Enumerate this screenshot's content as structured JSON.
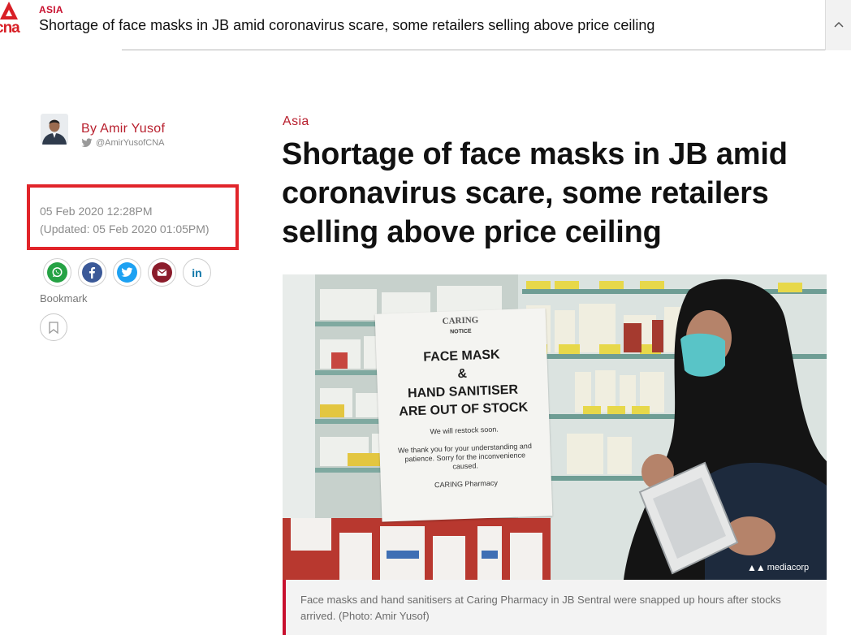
{
  "topbar": {
    "logo_text": "cna",
    "category": "ASIA",
    "title": "Shortage of face masks in JB amid coronavirus scare, some retailers selling above price ceiling",
    "collapse_icon": "chevron-up-icon"
  },
  "author": {
    "name": "By Amir Yusof",
    "handle": "@AmirYusofCNA",
    "handle_icon": "twitter-icon"
  },
  "dates": {
    "published": "05 Feb 2020 12:28PM",
    "updated": "(Updated: 05 Feb 2020 01:05PM)"
  },
  "share": {
    "buttons": [
      {
        "name": "whatsapp",
        "icon": "whatsapp-icon",
        "color": "#25a244"
      },
      {
        "name": "facebook",
        "icon": "facebook-icon",
        "color": "#3b5998"
      },
      {
        "name": "twitter",
        "icon": "twitter-icon",
        "color": "#1da1f2"
      },
      {
        "name": "email",
        "icon": "envelope-icon",
        "color": "#8b1c2b"
      },
      {
        "name": "linkedin",
        "icon": "linkedin-icon",
        "color": "#0e76a8"
      }
    ],
    "bookmark_label": "Bookmark",
    "bookmark_icon": "bookmark-icon"
  },
  "article": {
    "category": "Asia",
    "headline": "Shortage of face masks in JB amid coronavirus scare, some retailers selling above price ceiling",
    "image": {
      "notice": {
        "brand": "CARING",
        "sub": "NOTICE",
        "line1": "FACE MASK",
        "line2": "&",
        "line3": "HAND SANITISER",
        "line4": "ARE OUT OF STOCK",
        "restock": "We will restock soon.",
        "thanks": "We thank you for your understanding and patience. Sorry for the inconvenience caused.",
        "sign": "CARING Pharmacy"
      },
      "watermark": "mediacorp"
    },
    "caption": "Face masks and hand sanitisers at Caring Pharmacy in JB Sentral were snapped up hours after stocks arrived. (Photo: Amir Yusof)"
  },
  "colors": {
    "brand_red": "#c8102e",
    "highlight_box": "#e1242a",
    "muted_text": "#8c8c8c"
  }
}
